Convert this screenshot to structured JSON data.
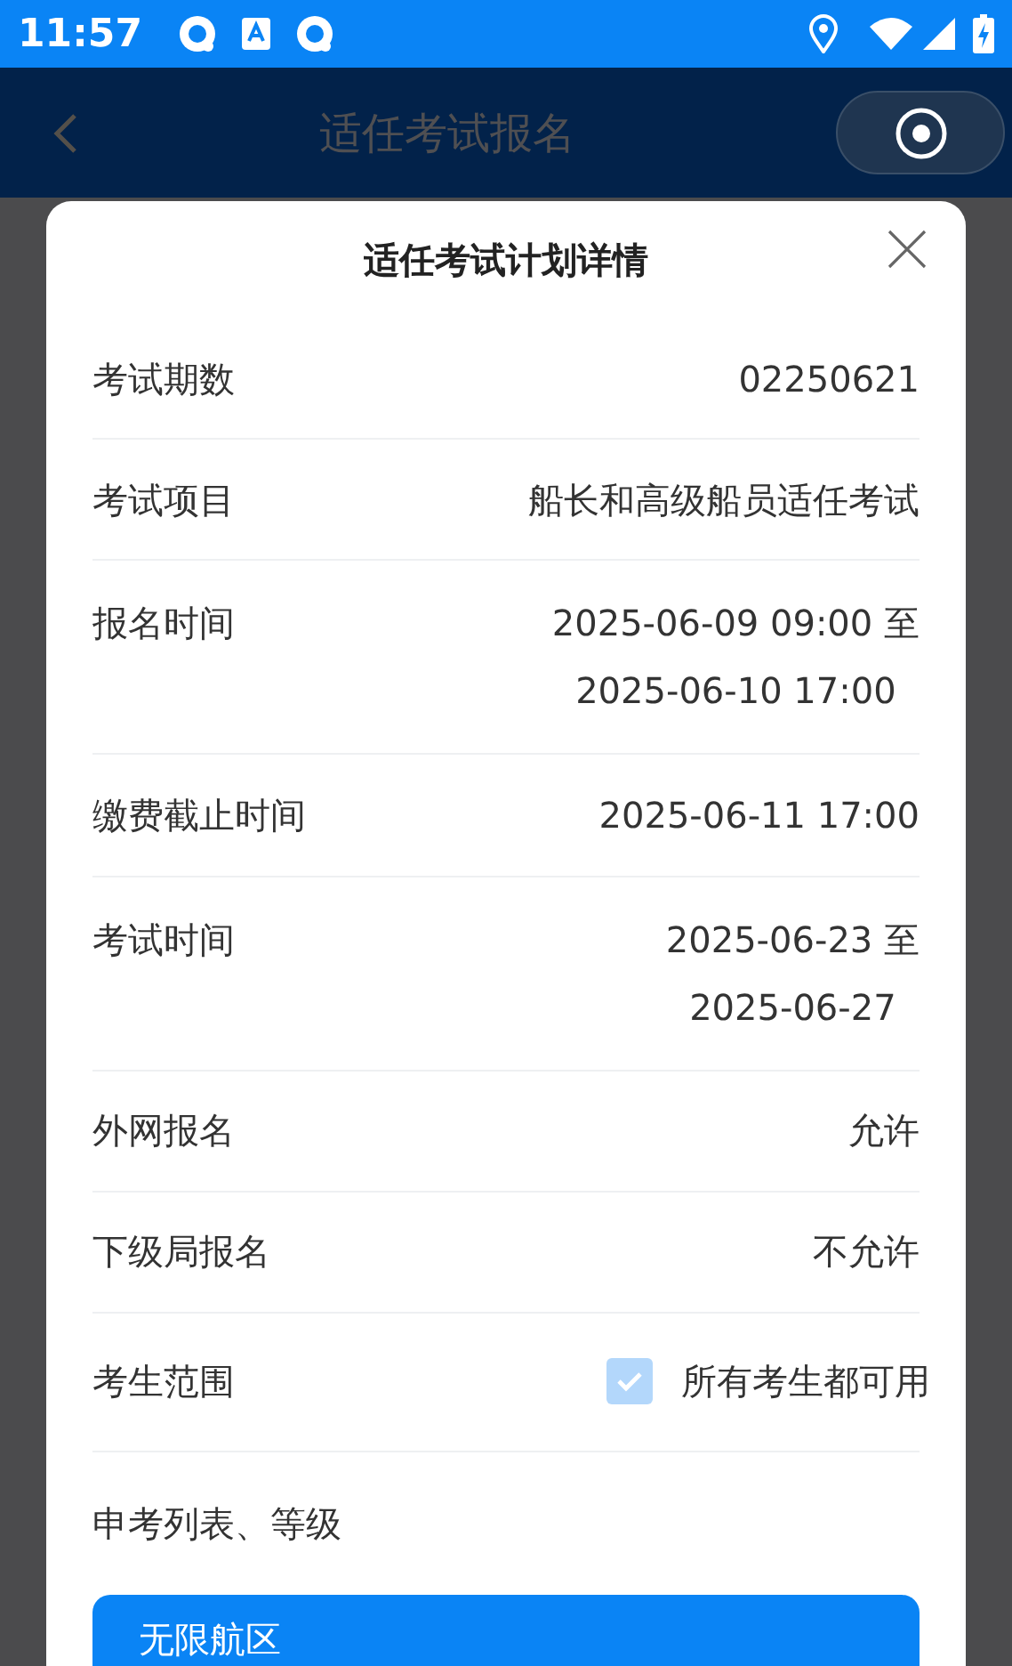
{
  "status_bar": {
    "time": "11:57"
  },
  "nav_bar": {
    "title": "适任考试报名"
  },
  "dialog": {
    "title": "适任考试计划详情",
    "rows": [
      {
        "kind": "text",
        "label": "考试期数",
        "lines": [
          "02250621"
        ]
      },
      {
        "kind": "text",
        "label": "考试项目",
        "lines": [
          "船长和高级船员适任考试"
        ]
      },
      {
        "kind": "text",
        "label": "报名时间",
        "lines": [
          "2025-06-09 09:00 至",
          "2025-06-10 17:00"
        ]
      },
      {
        "kind": "text",
        "label": "缴费截止时间",
        "lines": [
          "2025-06-11 17:00"
        ]
      },
      {
        "kind": "text",
        "label": "考试时间",
        "lines": [
          "2025-06-23 至",
          "2025-06-27"
        ]
      },
      {
        "kind": "text",
        "label": "外网报名",
        "lines": [
          "允许"
        ]
      },
      {
        "kind": "text",
        "label": "下级局报名",
        "lines": [
          "不允许"
        ]
      },
      {
        "kind": "checkbox",
        "label": "考生范围",
        "option": "所有考生都可用",
        "checked": true,
        "disabled": true
      }
    ],
    "section": {
      "title": "申考列表、等级",
      "items": [
        {
          "label": "无限航区"
        }
      ]
    }
  }
}
